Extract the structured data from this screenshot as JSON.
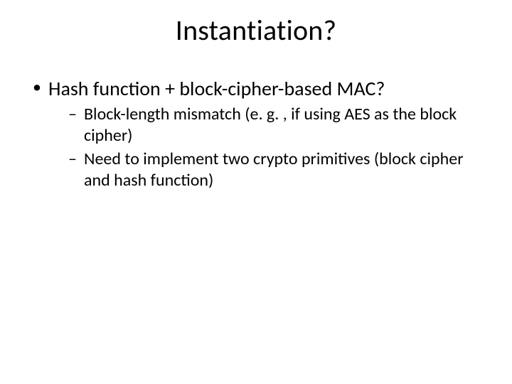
{
  "title": "Instantiation?",
  "bullets": [
    {
      "text": "Hash function + block-cipher-based MAC?",
      "children": [
        {
          "text": "Block-length mismatch (e. g. , if using AES as the block cipher)"
        },
        {
          "text": "Need to implement two crypto primitives (block cipher and hash function)"
        }
      ]
    }
  ]
}
